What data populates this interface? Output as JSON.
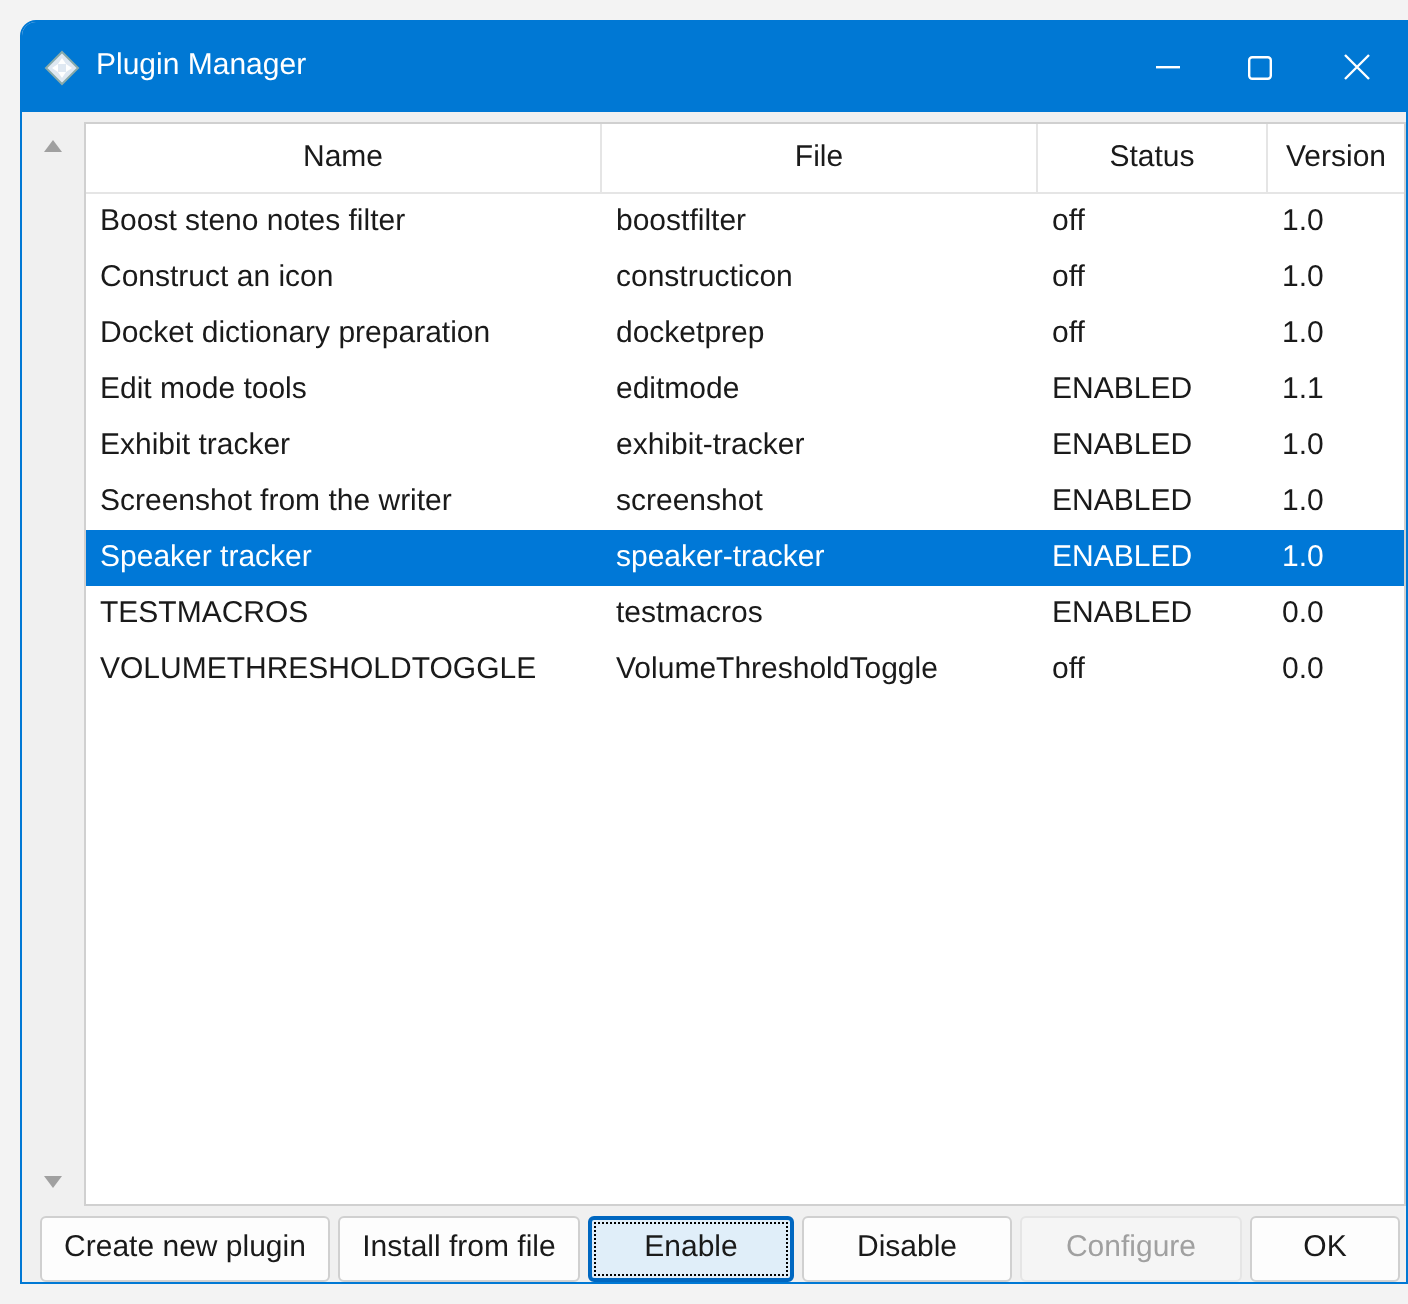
{
  "window": {
    "title": "Plugin Manager"
  },
  "table": {
    "columns": [
      "Name",
      "File",
      "Status",
      "Version"
    ],
    "rows": [
      {
        "cells": [
          "Boost steno notes filter",
          "boostfilter",
          "off",
          "1.0"
        ],
        "selected": false
      },
      {
        "cells": [
          "Construct an icon",
          "constructicon",
          "off",
          "1.0"
        ],
        "selected": false
      },
      {
        "cells": [
          "Docket dictionary preparation",
          "docketprep",
          "off",
          "1.0"
        ],
        "selected": false
      },
      {
        "cells": [
          "Edit mode tools",
          "editmode",
          "ENABLED",
          "1.1"
        ],
        "selected": false
      },
      {
        "cells": [
          "Exhibit tracker",
          "exhibit-tracker",
          "ENABLED",
          "1.0"
        ],
        "selected": false
      },
      {
        "cells": [
          "Screenshot from the writer",
          "screenshot",
          "ENABLED",
          "1.0"
        ],
        "selected": false
      },
      {
        "cells": [
          "Speaker tracker",
          "speaker-tracker",
          "ENABLED",
          "1.0"
        ],
        "selected": true
      },
      {
        "cells": [
          "TESTMACROS",
          "testmacros",
          "ENABLED",
          "0.0"
        ],
        "selected": false
      },
      {
        "cells": [
          "VOLUMETHRESHOLDTOGGLE",
          "VolumeThresholdToggle",
          "off",
          "0.0"
        ],
        "selected": false
      }
    ]
  },
  "buttons": [
    {
      "label": "Create new plugin",
      "focused": false,
      "disabled": false
    },
    {
      "label": "Install from file",
      "focused": false,
      "disabled": false
    },
    {
      "label": "Enable",
      "focused": true,
      "disabled": false
    },
    {
      "label": "Disable",
      "focused": false,
      "disabled": false
    },
    {
      "label": "Configure",
      "focused": false,
      "disabled": true
    },
    {
      "label": "OK",
      "focused": false,
      "disabled": false
    }
  ]
}
